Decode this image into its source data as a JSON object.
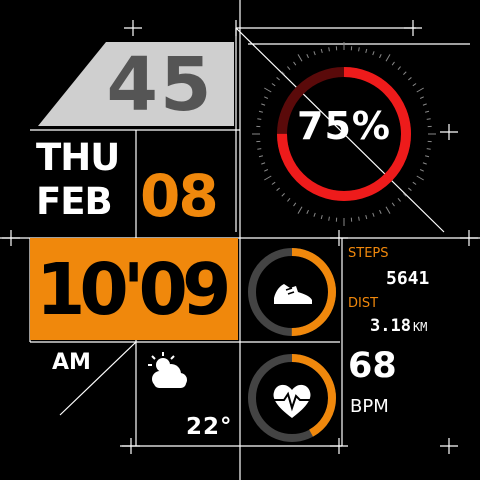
{
  "colors": {
    "accent": "#f0880c",
    "ring_red": "#ee1b1b",
    "ring_dark": "#5a0a0a",
    "gray": "#444444",
    "badge_gray": "#cfcfcf"
  },
  "badge": {
    "number": "45"
  },
  "date": {
    "weekday": "THU",
    "month": "FEB",
    "day": "08"
  },
  "time": {
    "display": "10'09",
    "ampm": "AM"
  },
  "weather": {
    "icon": "partly-cloudy-icon",
    "temperature": "22°"
  },
  "battery": {
    "percent_label": "75%",
    "level": 0.75
  },
  "activity": {
    "icon": "shoe-icon",
    "steps_label": "STEPS",
    "steps_value": "5641",
    "dist_label": "DIST",
    "dist_value": "3.18",
    "dist_unit": "KM",
    "progress": 0.5
  },
  "heart": {
    "icon": "heart-pulse-icon",
    "bpm_value": "68",
    "bpm_unit": "BPM",
    "progress": 0.42
  }
}
